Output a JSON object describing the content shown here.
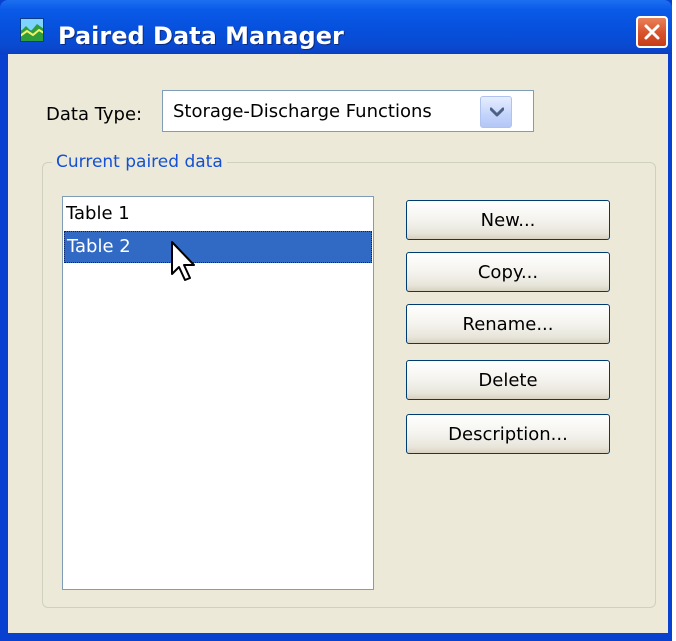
{
  "window": {
    "title": "Paired Data Manager",
    "app_icon": "paired-data-chart-icon",
    "close_icon": "close-icon"
  },
  "data_type": {
    "label": "Data Type:",
    "selected": "Storage-Discharge Functions",
    "dropdown_icon": "chevron-down-icon"
  },
  "group": {
    "legend": "Current paired data",
    "items": [
      {
        "label": "Table 1",
        "selected": false
      },
      {
        "label": "Table 2",
        "selected": true
      }
    ]
  },
  "buttons": {
    "new": "New...",
    "copy": "Copy...",
    "rename": "Rename...",
    "delete": "Delete",
    "description": "Description..."
  },
  "colors": {
    "title_bar": "#0a5ae8",
    "selection": "#316ac5",
    "legend_text": "#1450d2",
    "dialog_face": "#ece9d8"
  }
}
